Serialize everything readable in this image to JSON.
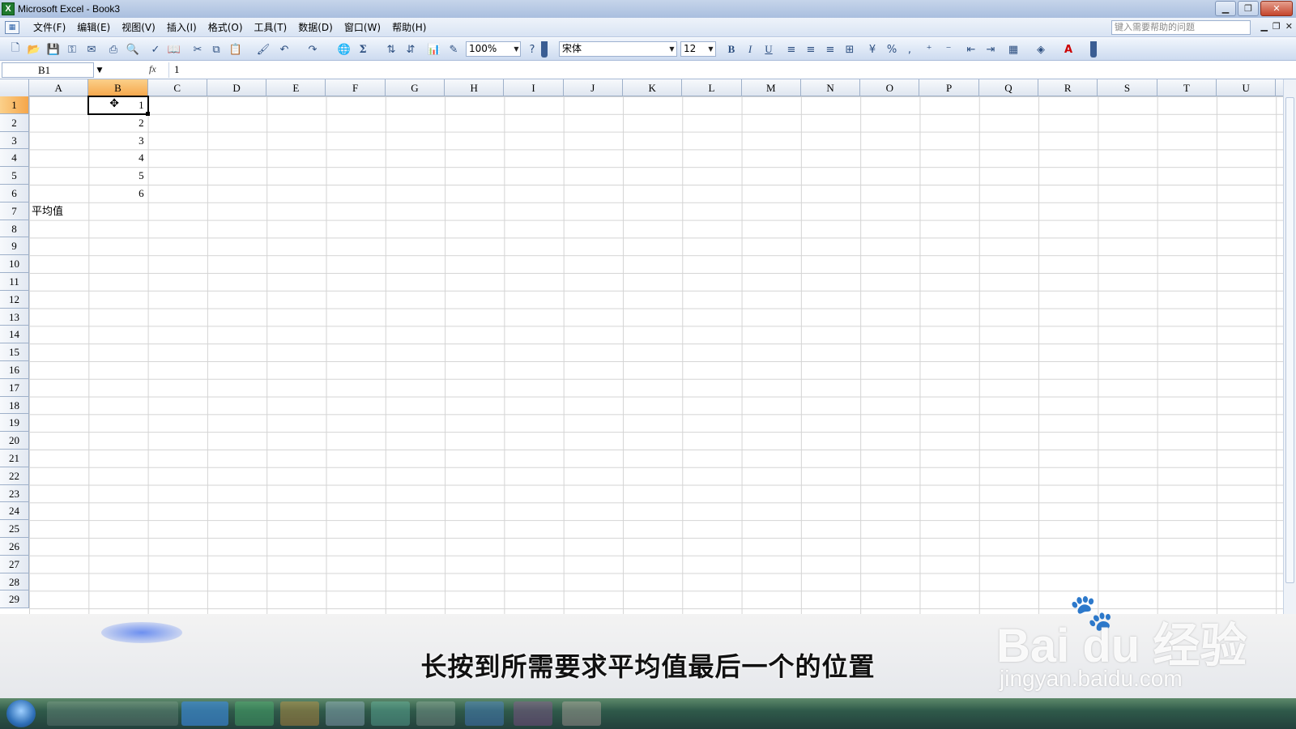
{
  "window": {
    "title": "Microsoft Excel - Book3"
  },
  "menu": {
    "items": [
      "文件(F)",
      "编辑(E)",
      "视图(V)",
      "插入(I)",
      "格式(O)",
      "工具(T)",
      "数据(D)",
      "窗口(W)",
      "帮助(H)"
    ],
    "help_placeholder": "键入需要帮助的问题"
  },
  "toolbar": {
    "zoom": "100%",
    "font_name": "宋体",
    "font_size": "12",
    "bold": "B",
    "italic": "I",
    "underline": "U",
    "percent": "%"
  },
  "formula_bar": {
    "name_box": "B1",
    "fx": "fx",
    "value": "1"
  },
  "sheet": {
    "columns": [
      "A",
      "B",
      "C",
      "D",
      "E",
      "F",
      "G",
      "H",
      "I",
      "J",
      "K",
      "L",
      "M",
      "N",
      "O",
      "P",
      "Q",
      "R",
      "S",
      "T",
      "U"
    ],
    "rows": [
      "1",
      "2",
      "3",
      "4",
      "5",
      "6",
      "7",
      "8",
      "9",
      "10",
      "11",
      "12",
      "13",
      "14",
      "15",
      "16",
      "17",
      "18",
      "19",
      "20",
      "21",
      "22",
      "23",
      "24",
      "25",
      "26",
      "27",
      "28",
      "29"
    ],
    "selected_column": "B",
    "selected_row": "1",
    "cells": {
      "B1": "1",
      "B2": "2",
      "B3": "3",
      "B4": "4",
      "B5": "5",
      "B6": "6",
      "A7": "平均值"
    }
  },
  "subtitle": "长按到所需要求平均值最后一个的位置",
  "watermark": {
    "logo": "Bai du 经验",
    "url": "jingyan.baidu.com"
  },
  "colors": {
    "selected_header": "#f5a64a",
    "grid_line": "#d4d4d4",
    "title_bar": "#a9bfdf",
    "taskbar": "#2f5a4a"
  }
}
